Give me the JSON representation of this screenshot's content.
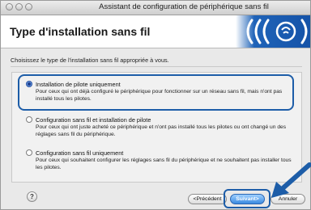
{
  "window": {
    "title": "Assistant de configuration de périphérique sans fil"
  },
  "header": {
    "title": "Type d'installation sans fil",
    "logo_icon": "wireless-signal-logo-icon"
  },
  "instruction": "Choisissez le type de l'installation sans fil appropriée à vous.",
  "options": [
    {
      "label": "Installation de pilote uniquement",
      "description": "Pour ceux qui ont déjà configuré le périphérique pour fonctionner sur un réseau sans fil, mais n'ont pas installé tous les pilotes.",
      "selected": true
    },
    {
      "label": "Configuration sans fil et installation de pilote",
      "description": "Pour ceux qui ont juste acheté ce périphérique et n'ont pas installé tous les pilotes ou ont changé un des réglages sans fil du périphérique.",
      "selected": false
    },
    {
      "label": "Configuration sans fil uniquement",
      "description": "Pour ceux qui souhaitent configurer les réglages sans fil du périphérique et ne souhaitent pas installer tous les pilotes.",
      "selected": false
    }
  ],
  "footer": {
    "help_label": "?",
    "prev_label": "<Précédent",
    "next_label": "Suivant>",
    "cancel_label": "Annuler"
  },
  "colors": {
    "accent": "#1d5da8",
    "logo_blue": "#1d5fb4"
  }
}
